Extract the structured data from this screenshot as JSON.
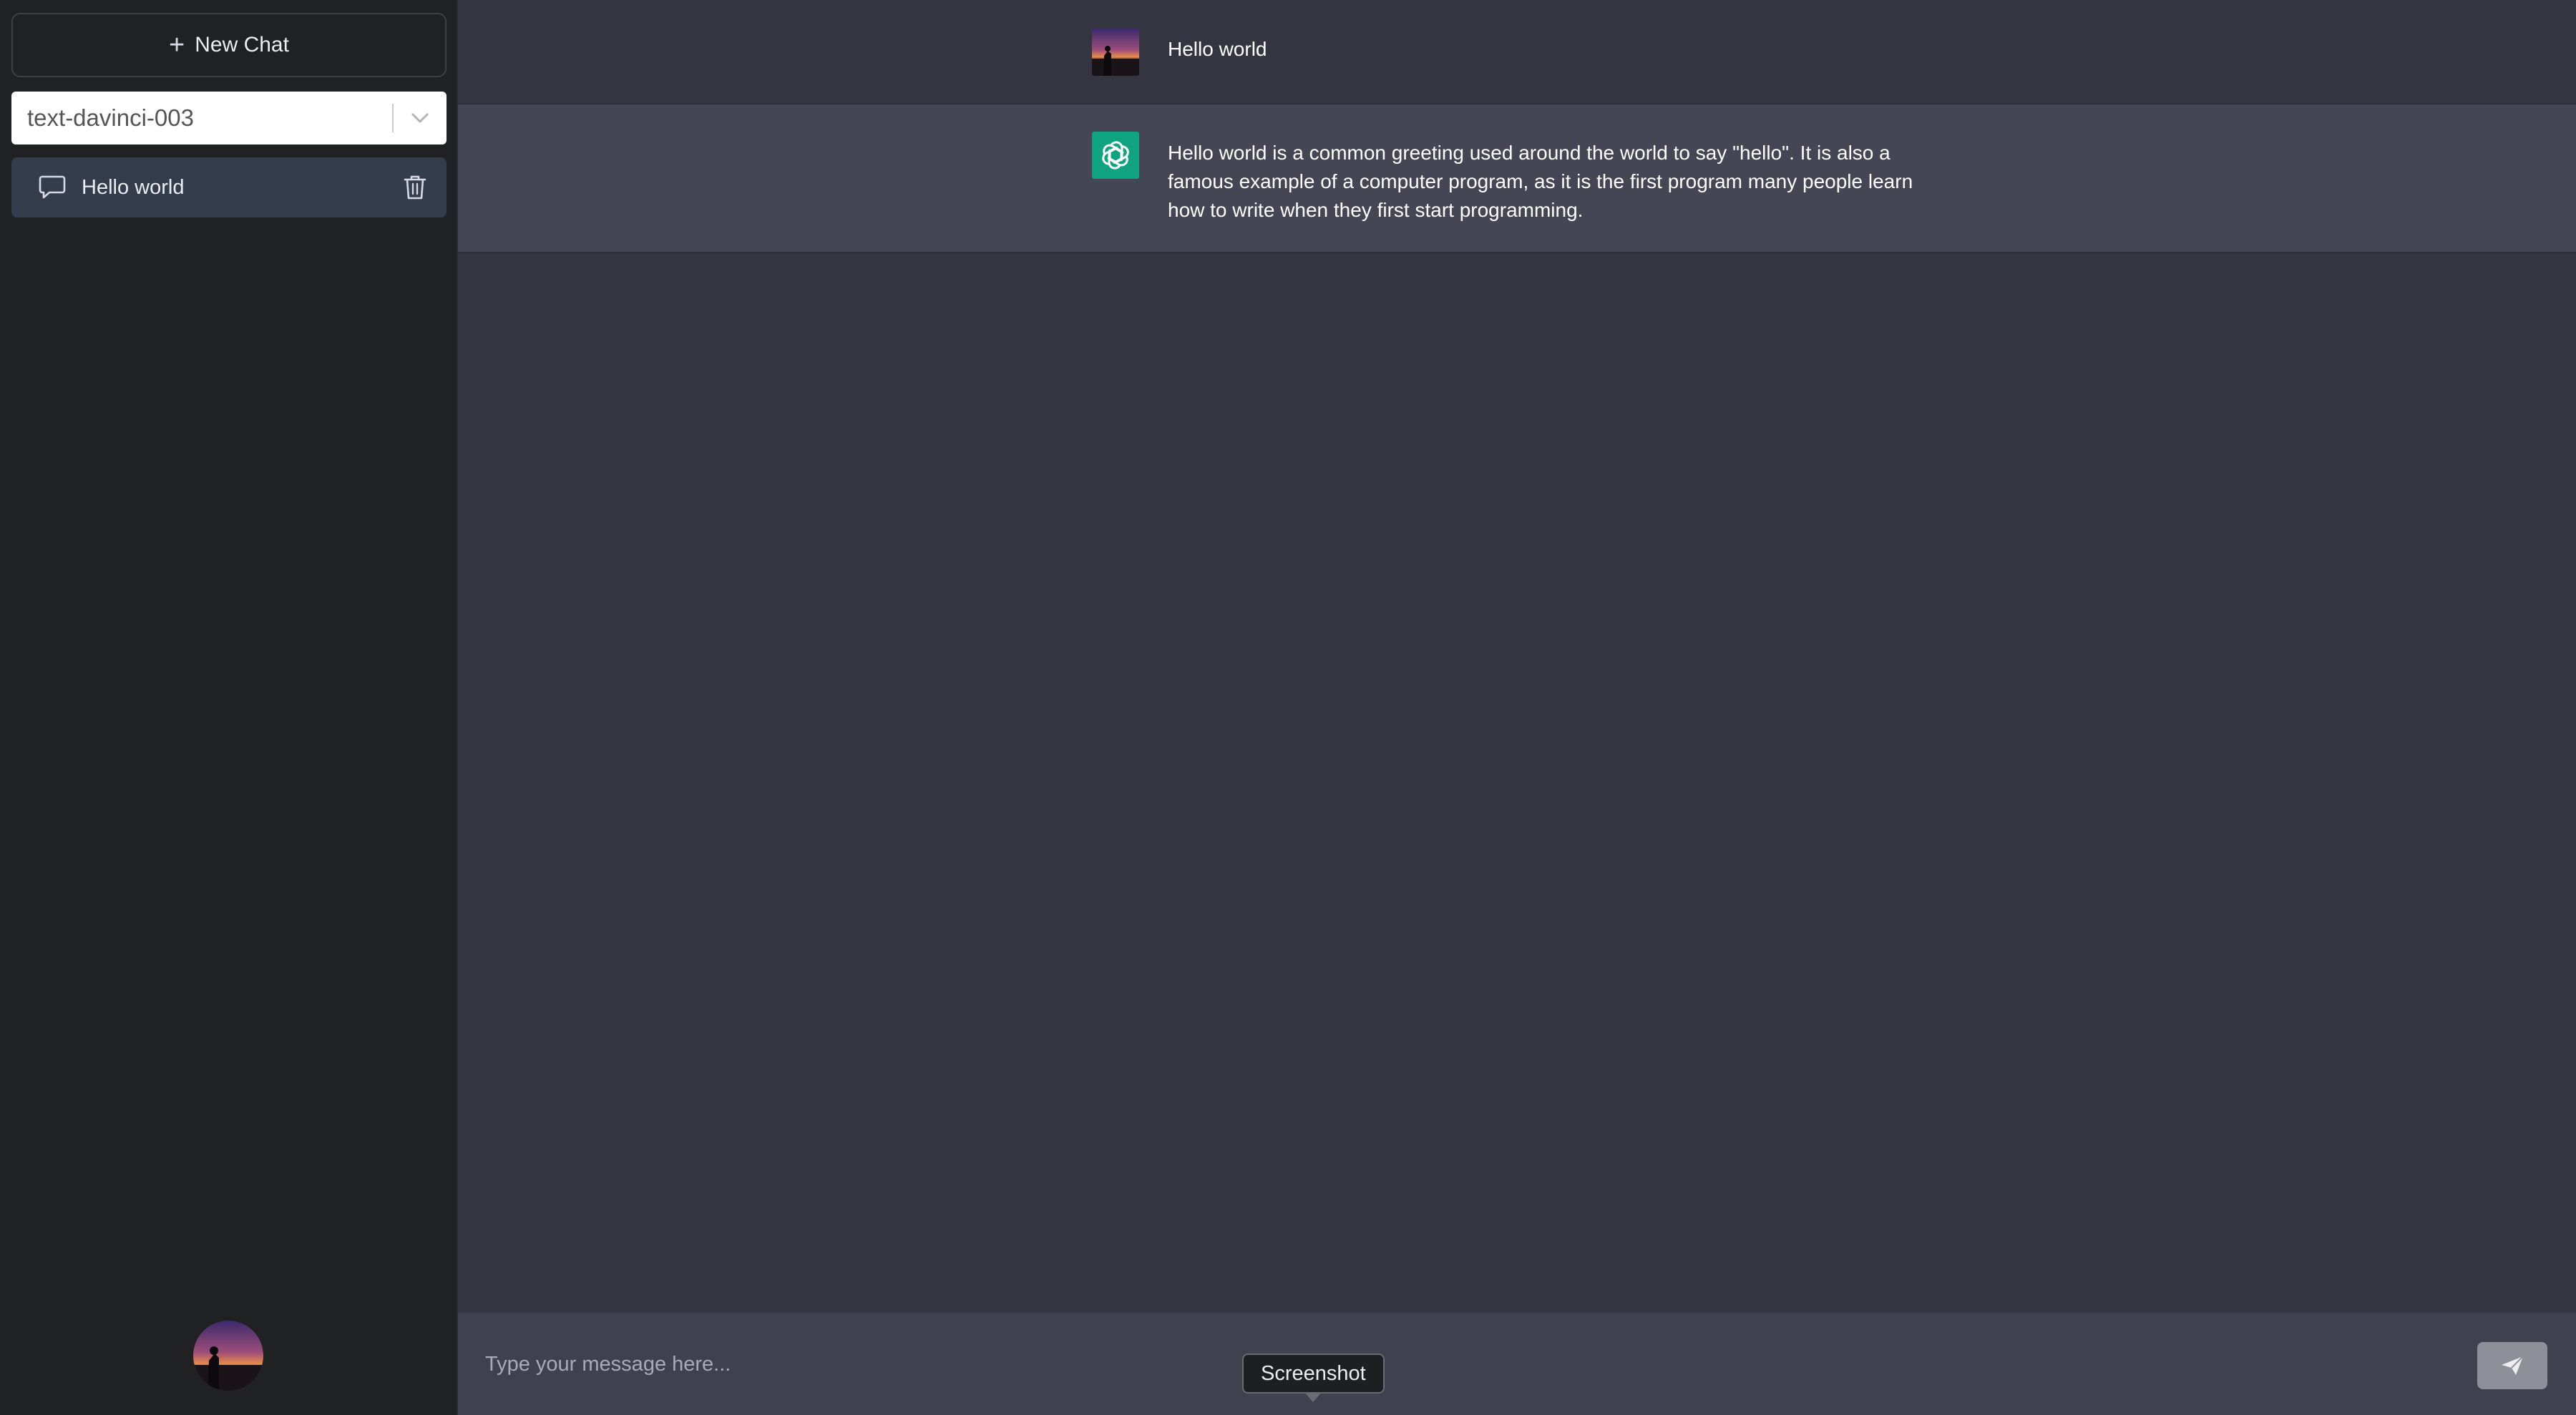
{
  "sidebar": {
    "new_chat_label": "New Chat",
    "model_select": {
      "selected": "text-davinci-003"
    },
    "conversations": [
      {
        "title": "Hello world"
      }
    ]
  },
  "messages": [
    {
      "role": "user",
      "text": "Hello world"
    },
    {
      "role": "assistant",
      "text": "Hello world is a common greeting used around the world to say \"hello\". It is also a famous example of a computer program, as it is the first program many people learn how to write when they first start programming."
    }
  ],
  "composer": {
    "placeholder": "Type your message here..."
  },
  "tooltip": {
    "label": "Screenshot"
  },
  "icons": {
    "new_chat": "plus-icon",
    "model_dropdown": "chevron-down-icon",
    "conversation": "chat-bubble-icon",
    "delete": "trash-icon",
    "send": "send-icon",
    "assistant": "openai-logo-icon"
  },
  "colors": {
    "sidebar_bg": "#202123",
    "main_bg": "#343541",
    "assistant_row_bg": "#444654",
    "composer_bg": "#40414f",
    "selected_conversation_bg": "#343d4c",
    "assistant_avatar_bg": "#10a37f"
  }
}
